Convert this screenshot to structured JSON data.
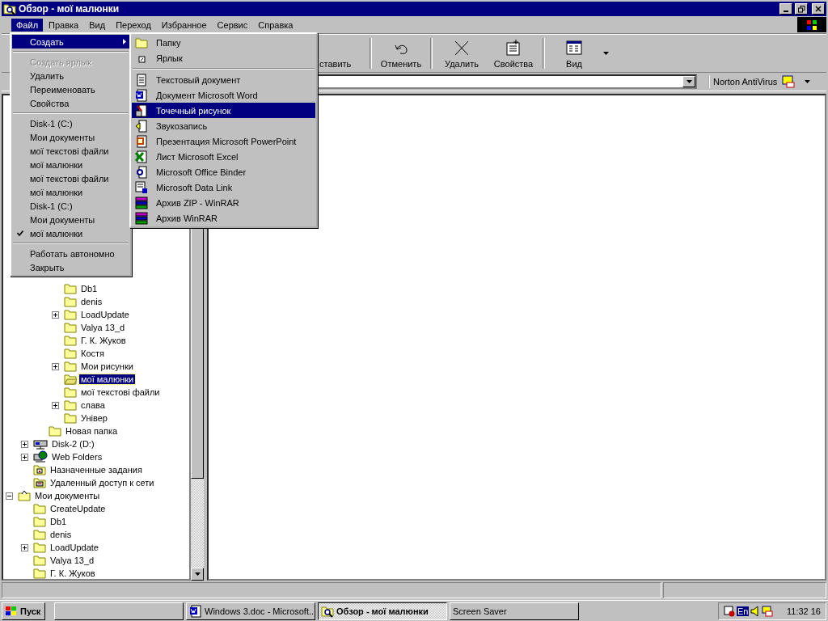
{
  "window": {
    "title": "Обзор - мої малюнки"
  },
  "menu_bar": [
    {
      "label": "Файл",
      "selected": true
    },
    {
      "label": "Правка",
      "selected": false
    },
    {
      "label": "Вид",
      "selected": false
    },
    {
      "label": "Переход",
      "selected": false
    },
    {
      "label": "Избранное",
      "selected": false
    },
    {
      "label": "Сервис",
      "selected": false
    },
    {
      "label": "Справка",
      "selected": false
    }
  ],
  "toolbar": [
    {
      "label": "ставить"
    },
    {
      "label": "Отменить"
    },
    {
      "label": "Удалить"
    },
    {
      "label": "Свойства"
    },
    {
      "label": "Вид"
    }
  ],
  "links_bar": {
    "label": "Norton AntiVirus"
  },
  "file_menu": [
    {
      "kind": "submenu",
      "label": "Создать",
      "selected": true,
      "disabled": false,
      "checked": false
    },
    {
      "kind": "separator"
    },
    {
      "kind": "item",
      "label": "Создать ярлык",
      "selected": false,
      "disabled": true,
      "checked": false
    },
    {
      "kind": "item",
      "label": "Удалить",
      "selected": false,
      "disabled": false,
      "checked": false
    },
    {
      "kind": "item",
      "label": "Переименовать",
      "selected": false,
      "disabled": false,
      "checked": false
    },
    {
      "kind": "item",
      "label": "Свойства",
      "selected": false,
      "disabled": false,
      "checked": false
    },
    {
      "kind": "separator"
    },
    {
      "kind": "item",
      "label": "Disk-1 (C:)",
      "selected": false,
      "disabled": false,
      "checked": false
    },
    {
      "kind": "item",
      "label": "Мои документы",
      "selected": false,
      "disabled": false,
      "checked": false
    },
    {
      "kind": "item",
      "label": "мої текстові файли",
      "selected": false,
      "disabled": false,
      "checked": false
    },
    {
      "kind": "item",
      "label": "мої малюнки",
      "selected": false,
      "disabled": false,
      "checked": false
    },
    {
      "kind": "item",
      "label": "мої текстові файли",
      "selected": false,
      "disabled": false,
      "checked": false
    },
    {
      "kind": "item",
      "label": "мої малюнки",
      "selected": false,
      "disabled": false,
      "checked": false
    },
    {
      "kind": "item",
      "label": "Disk-1 (C:)",
      "selected": false,
      "disabled": false,
      "checked": false
    },
    {
      "kind": "item",
      "label": "Мои документы",
      "selected": false,
      "disabled": false,
      "checked": false
    },
    {
      "kind": "item",
      "label": "мої малюнки",
      "selected": false,
      "disabled": false,
      "checked": true
    },
    {
      "kind": "separator"
    },
    {
      "kind": "item",
      "label": "Работать автономно",
      "selected": false,
      "disabled": false,
      "checked": false
    },
    {
      "kind": "item",
      "label": "Закрыть",
      "selected": false,
      "disabled": false,
      "checked": false
    }
  ],
  "new_submenu": [
    {
      "kind": "folder",
      "label": "Папку",
      "selected": false
    },
    {
      "kind": "shortcut",
      "label": "Ярлык",
      "selected": false
    },
    {
      "kind": "separator"
    },
    {
      "kind": "text",
      "label": "Текстовый документ",
      "selected": false
    },
    {
      "kind": "word",
      "label": "Документ Microsoft Word",
      "selected": false
    },
    {
      "kind": "paint",
      "label": "Точечный рисунок",
      "selected": true
    },
    {
      "kind": "sound",
      "label": "Звукозапись",
      "selected": false
    },
    {
      "kind": "powerpoint",
      "label": "Презентация Microsoft PowerPoint",
      "selected": false
    },
    {
      "kind": "excel",
      "label": "Лист Microsoft Excel",
      "selected": false
    },
    {
      "kind": "binder",
      "label": "Microsoft Office Binder",
      "selected": false
    },
    {
      "kind": "datalink",
      "label": "Microsoft Data Link",
      "selected": false
    },
    {
      "kind": "rar",
      "label": "Архив ZIP - WinRAR",
      "selected": false
    },
    {
      "kind": "rar",
      "label": "Архив WinRAR",
      "selected": false
    }
  ],
  "tree": [
    {
      "children": [
        {
          "children": [
            {
              "children": [
                {
                  "kind": "folder",
                  "label": "Db1",
                  "selected": false
                },
                {
                  "kind": "folder",
                  "label": "denis",
                  "selected": false
                },
                {
                  "kind": "folder",
                  "label": "LoadUpdate",
                  "selected": false,
                  "expanded": false
                },
                {
                  "kind": "folder",
                  "label": "Valya 13_d",
                  "selected": false
                },
                {
                  "kind": "folder",
                  "label": "Г. К. Жуков",
                  "selected": false
                },
                {
                  "kind": "folder",
                  "label": "Костя",
                  "selected": false
                },
                {
                  "kind": "folder",
                  "label": "Мои рисунки",
                  "selected": false,
                  "expanded": false
                },
                {
                  "kind": "open-folder",
                  "label": "мої малюнки",
                  "selected": true
                },
                {
                  "kind": "folder",
                  "label": "мої текстові файли",
                  "selected": false
                },
                {
                  "kind": "folder",
                  "label": "слава",
                  "selected": false,
                  "expanded": false
                },
                {
                  "kind": "folder",
                  "label": "Універ",
                  "selected": false
                }
              ]
            },
            {
              "kind": "folder",
              "label": "Новая папка",
              "selected": false
            }
          ]
        },
        {
          "kind": "drive",
          "label": "Disk-2 (D:)",
          "selected": false,
          "expanded": false
        },
        {
          "kind": "web",
          "label": "Web Folders",
          "selected": false,
          "expanded": false
        },
        {
          "kind": "tasks",
          "label": "Назначенные задания",
          "selected": false
        },
        {
          "kind": "dialup",
          "label": "Удаленный доступ к сети",
          "selected": false
        }
      ]
    },
    {
      "kind": "documents",
      "label": "Мои документы",
      "selected": false,
      "expanded": true,
      "children": [
        {
          "kind": "folder",
          "label": "CreateUpdate",
          "selected": false
        },
        {
          "kind": "folder",
          "label": "Db1",
          "selected": false
        },
        {
          "kind": "folder",
          "label": "denis",
          "selected": false
        },
        {
          "kind": "folder",
          "label": "LoadUpdate",
          "selected": false,
          "expanded": false
        },
        {
          "kind": "folder",
          "label": "Valya 13_d",
          "selected": false
        },
        {
          "kind": "folder",
          "label": "Г. К. Жуков",
          "selected": false
        }
      ]
    }
  ],
  "taskbar": {
    "start": "Пуск",
    "tasks": [
      {
        "kind": "word",
        "label": "Windows 3.doc - Microsoft...",
        "selected": false
      },
      {
        "kind": "explorer",
        "label": "Обзор - мої малюнки",
        "selected": true
      },
      {
        "kind": "plain",
        "label": "Screen Saver",
        "selected": false
      }
    ],
    "language": "En",
    "clock": "11:32 16"
  }
}
